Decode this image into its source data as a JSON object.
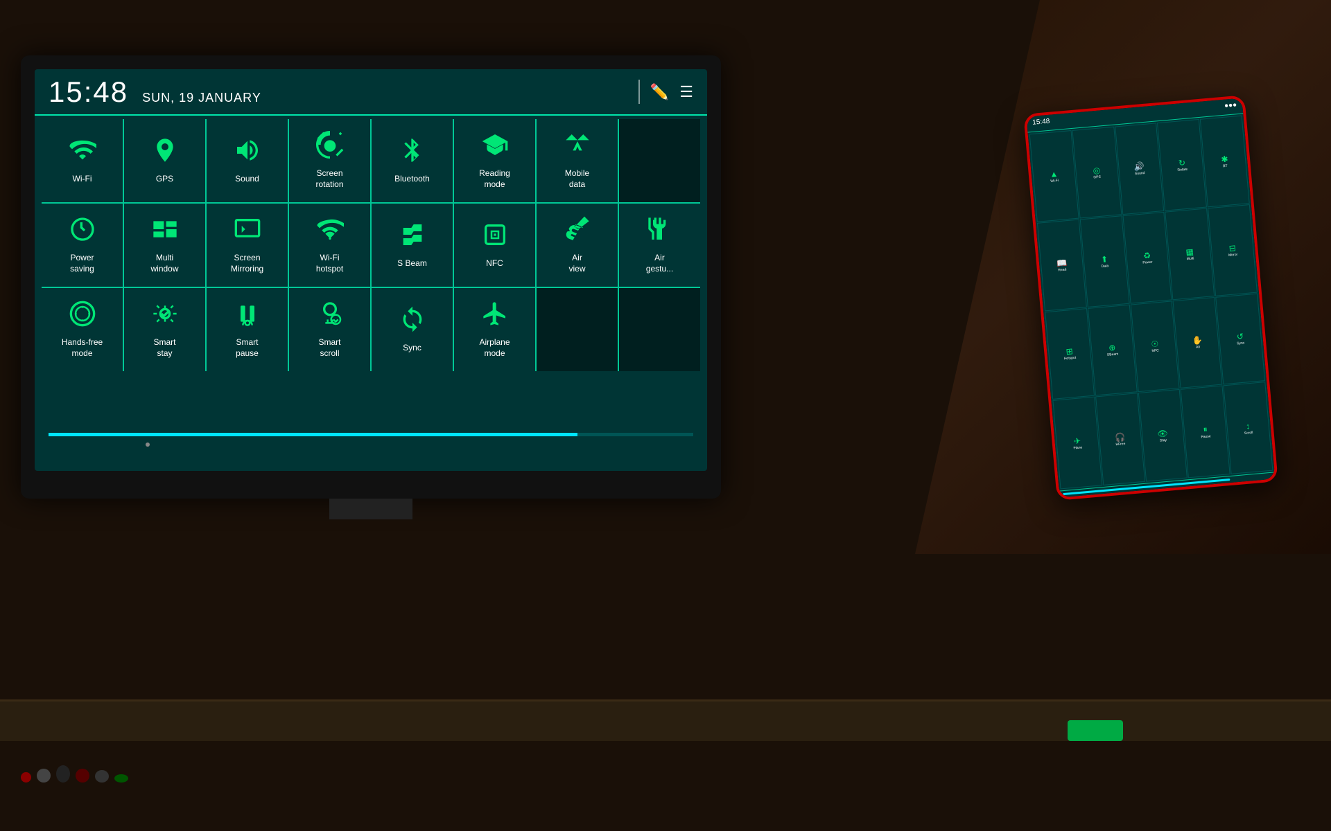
{
  "tv": {
    "time": "15:48",
    "date": "SUN, 19 JANUARY"
  },
  "quickSettings": {
    "row1": [
      {
        "id": "wifi",
        "label": "Wi-Fi",
        "icon": "wifi"
      },
      {
        "id": "gps",
        "label": "GPS",
        "icon": "gps"
      },
      {
        "id": "sound",
        "label": "Sound",
        "icon": "sound"
      },
      {
        "id": "screen-rotation",
        "label": "Screen\nrotation",
        "icon": "rotation"
      },
      {
        "id": "bluetooth",
        "label": "Bluetooth",
        "icon": "bluetooth"
      },
      {
        "id": "reading-mode",
        "label": "Reading\nmode",
        "icon": "reading"
      },
      {
        "id": "mobile-data",
        "label": "Mobile\ndata",
        "icon": "mobiledata"
      },
      {
        "id": "partial",
        "label": "",
        "icon": "partial"
      }
    ],
    "row2": [
      {
        "id": "power-saving",
        "label": "Power\nsaving",
        "icon": "power"
      },
      {
        "id": "multi-window",
        "label": "Multi\nwindow",
        "icon": "multiwindow"
      },
      {
        "id": "screen-mirroring",
        "label": "Screen\nMirroring",
        "icon": "mirroring"
      },
      {
        "id": "wifi-hotspot",
        "label": "Wi-Fi\nhotspot",
        "icon": "hotspot"
      },
      {
        "id": "s-beam",
        "label": "S Beam",
        "icon": "sbeam"
      },
      {
        "id": "nfc",
        "label": "NFC",
        "icon": "nfc"
      },
      {
        "id": "air-view",
        "label": "Air\nview",
        "icon": "airview"
      },
      {
        "id": "air-gesture",
        "label": "Air\ngestu...",
        "icon": "airgesture"
      }
    ],
    "row3": [
      {
        "id": "hands-free",
        "label": "Hands-free\nmode",
        "icon": "handsfree"
      },
      {
        "id": "smart-stay",
        "label": "Smart\nstay",
        "icon": "smartstay"
      },
      {
        "id": "smart-pause",
        "label": "Smart\npause",
        "icon": "smartpause"
      },
      {
        "id": "smart-scroll",
        "label": "Smart\nscroll",
        "icon": "smartscroll"
      },
      {
        "id": "sync",
        "label": "Sync",
        "icon": "sync"
      },
      {
        "id": "airplane",
        "label": "Airplane\nmode",
        "icon": "airplane"
      },
      {
        "id": "empty1",
        "label": "",
        "icon": ""
      },
      {
        "id": "empty2",
        "label": "",
        "icon": ""
      }
    ]
  },
  "phone": {
    "time": "15:48"
  }
}
